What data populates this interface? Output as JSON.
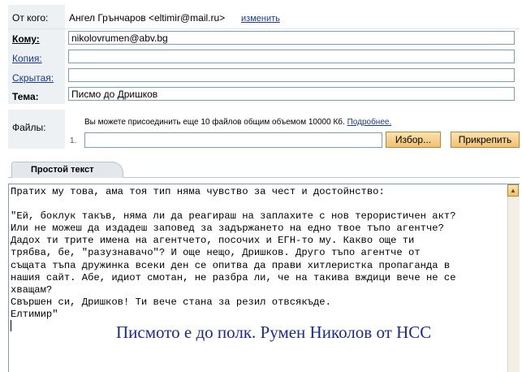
{
  "from": {
    "label": "От кого:",
    "value": "Ангел Грънчаров  <eltimir@mail.ru>",
    "change_link": "изменить"
  },
  "to": {
    "label": "Кому:",
    "value": "nikolovrumen@abv.bg"
  },
  "cc": {
    "label": "Копия:",
    "value": ""
  },
  "bcc": {
    "label": "Скрытая:",
    "value": ""
  },
  "subject": {
    "label": "Тема:",
    "value": "Писмо до Дришков"
  },
  "files": {
    "label": "Файлы:",
    "info": "Вы можете присоединить еще 10 файлов общим объемом 10000 Кб.",
    "more_link": "Подробнее.",
    "row_number": "1.",
    "browse_button": "Избор...",
    "attach_button": "Прикрепить"
  },
  "editor": {
    "tab_label": "Простой текст",
    "body": "Пратих му това, ама тоя тип няма чувство за чест и достойнство:\n\n\"Ей, боклук такъв, няма ли да реагираш на заплахите с нов терористичен акт?\nИли не можеш да издадеш заповед за задържането на едно твое тъпо агентче?\nДадох ти трите имена на агентчето, посочих и ЕГН-то му. Какво още ти\nтрябва, бе, \"разузнавачо\"? И още нещо, Дришков. Друго тъпо агентче от\nсъщата тъпа дружинка всеки ден се опитва да прави хитлеристка пропаганда в\nнашия сайт. Абе, идиот смотан, не разбра ли, че на такива вждици вече не се\nхващам?\nСвършен си, Дришков! Ти вече стана за резил отвсякъде.\nЕлтимир\"",
    "overlay_caption": "Писмото е до полк. Румен Николов от НСС"
  },
  "colors": {
    "link": "#1a3a8a",
    "button_fill": "#f2c070",
    "field_border": "#7f9db9",
    "caption": "#1e2a8a"
  }
}
